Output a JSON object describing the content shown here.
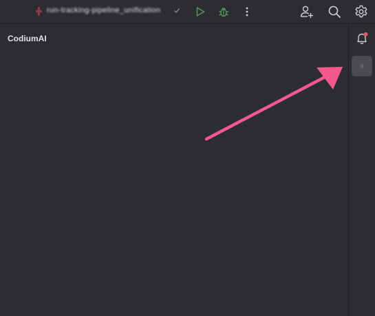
{
  "toolbar": {
    "run_config_name": "run-tracking-pipeline_unification",
    "run_config_status_icon": "check-icon",
    "icons": [
      "run-icon",
      "debug-icon",
      "more-vertical-icon",
      "add-user-icon",
      "search-icon",
      "settings-gear-icon"
    ],
    "run_color": "#57965c",
    "debug_color": "#57965c"
  },
  "panel": {
    "title": "CodiumAI"
  },
  "right_strip": {
    "icons": [
      "notifications-bell-icon",
      "codiumai-tool-window-icon"
    ],
    "notification_badge_color": "#e55765",
    "selected_button_color": "#4a4c50"
  },
  "annotation": {
    "arrow_color": "#f1598f",
    "arrow_icon": "pointer-arrow"
  }
}
